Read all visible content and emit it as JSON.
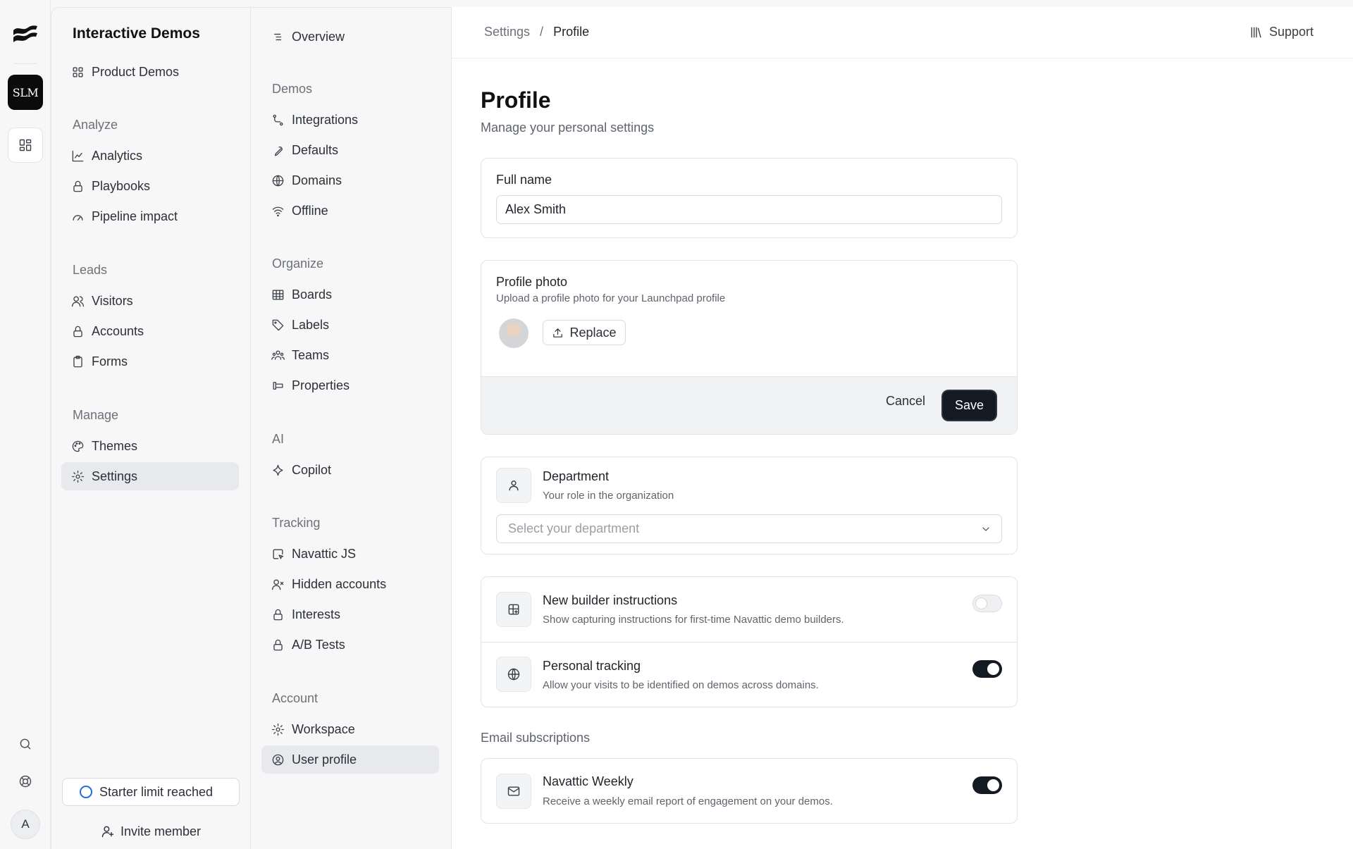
{
  "rail": {
    "workspace_logo_text": "SLM",
    "account_initial": "A"
  },
  "sidebar": {
    "title": "Interactive Demos",
    "product_demos": "Product Demos",
    "analyze_header": "Analyze",
    "analytics": "Analytics",
    "playbooks": "Playbooks",
    "pipeline_impact": "Pipeline impact",
    "leads_header": "Leads",
    "visitors": "Visitors",
    "accounts": "Accounts",
    "forms": "Forms",
    "manage_header": "Manage",
    "themes": "Themes",
    "settings": "Settings",
    "starter_limit": "Starter limit reached",
    "invite_member": "Invite member"
  },
  "settings_nav": {
    "overview": "Overview",
    "demos_header": "Demos",
    "integrations": "Integrations",
    "defaults": "Defaults",
    "domains": "Domains",
    "offline": "Offline",
    "organize_header": "Organize",
    "boards": "Boards",
    "labels": "Labels",
    "teams": "Teams",
    "properties": "Properties",
    "ai_header": "AI",
    "copilot": "Copilot",
    "tracking_header": "Tracking",
    "navattic_js": "Navattic JS",
    "hidden_accounts": "Hidden accounts",
    "interests": "Interests",
    "ab_tests": "A/B Tests",
    "account_header": "Account",
    "workspace": "Workspace",
    "user_profile": "User profile"
  },
  "header": {
    "breadcrumb_parent": "Settings",
    "breadcrumb_sep": "/",
    "breadcrumb_current": "Profile",
    "support": "Support"
  },
  "page": {
    "title": "Profile",
    "subtitle": "Manage your personal settings"
  },
  "full_name": {
    "label": "Full name",
    "value": "Alex Smith"
  },
  "profile_photo": {
    "label": "Profile photo",
    "description": "Upload a profile photo for your Launchpad profile",
    "replace": "Replace",
    "cancel": "Cancel",
    "save": "Save"
  },
  "department": {
    "label": "Department",
    "description": "Your role in the organization",
    "placeholder": "Select your department"
  },
  "builder_instructions": {
    "label": "New builder instructions",
    "description": "Show capturing instructions for first-time Navattic demo builders.",
    "enabled": false
  },
  "personal_tracking": {
    "label": "Personal tracking",
    "description": "Allow your visits to be identified on demos across domains.",
    "enabled": true
  },
  "email_subscriptions": {
    "header": "Email subscriptions",
    "weekly_label": "Navattic Weekly",
    "weekly_description": "Receive a weekly email report of engagement on your demos.",
    "enabled": true
  }
}
